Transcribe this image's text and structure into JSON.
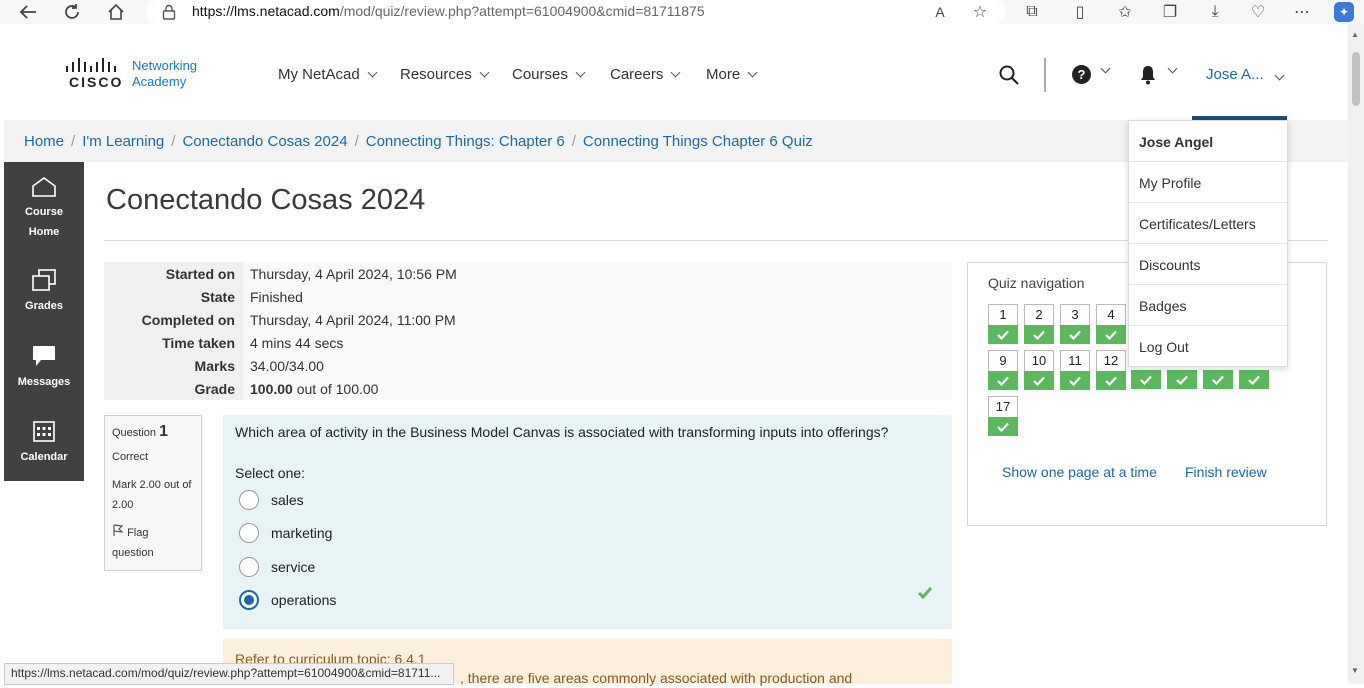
{
  "browser": {
    "url_host": "https://lms.netacad.com",
    "url_path": "/mod/quiz/review.php?attempt=61004900&cmid=81711875"
  },
  "header": {
    "brand_line1": "Networking",
    "brand_line2": "Academy",
    "logo_word": "CISCO",
    "nav": [
      "My NetAcad",
      "Resources",
      "Courses",
      "Careers",
      "More"
    ],
    "user": "Jose A..."
  },
  "breadcrumb": [
    "Home",
    "I'm Learning",
    "Conectando Cosas 2024",
    "Connecting Things: Chapter 6",
    "Connecting Things Chapter 6 Quiz"
  ],
  "sidebar": {
    "items": [
      {
        "label_line1": "Course",
        "label_line2": "Home"
      },
      {
        "label_line1": "Grades"
      },
      {
        "label_line1": "Messages"
      },
      {
        "label_line1": "Calendar"
      }
    ]
  },
  "page": {
    "title": "Conectando Cosas 2024"
  },
  "summary": [
    {
      "label": "Started on",
      "value": "Thursday, 4 April 2024, 10:56 PM"
    },
    {
      "label": "State",
      "value": "Finished"
    },
    {
      "label": "Completed on",
      "value": "Thursday, 4 April 2024, 11:00 PM"
    },
    {
      "label": "Time taken",
      "value": "4 mins 44 secs"
    },
    {
      "label": "Marks",
      "value": "34.00/34.00"
    },
    {
      "label": "Grade",
      "value_bold": "100.00",
      "value_rest": " out of 100.00"
    }
  ],
  "question": {
    "label": "Question",
    "number": "1",
    "status": "Correct",
    "mark": "Mark 2.00 out of 2.00",
    "flag_line1": "Flag",
    "flag_line2": "question",
    "text": "Which area of activity in the Business Model Canvas is associated with transforming inputs into offerings?",
    "select_one": "Select one:",
    "options": [
      "sales",
      "marketing",
      "service",
      "operations"
    ],
    "selected_index": 3,
    "feedback_line1": "Refer to curriculum topic: 6.4.1",
    "feedback_line2": ", there are five areas commonly associated with production and"
  },
  "quiz_nav": {
    "title": "Quiz navigation",
    "buttons": [
      "1",
      "2",
      "3",
      "4",
      "9",
      "10",
      "11",
      "12",
      "17"
    ],
    "show_one_page": "Show one page at a time",
    "finish_review": "Finish review"
  },
  "user_dropdown": {
    "name": "Jose Angel",
    "items": [
      "My Profile",
      "Certificates/Letters",
      "Discounts",
      "Badges",
      "Log Out"
    ]
  },
  "status_url": "https://lms.netacad.com/mod/quiz/review.php?attempt=61004900&cmid=81711...",
  "colors": {
    "link": "#1b6aa5",
    "sidebar": "#414141",
    "correct_green": "#5cb85c",
    "question_bg": "#e7f3f5",
    "feedback_bg": "#fcefdc"
  }
}
